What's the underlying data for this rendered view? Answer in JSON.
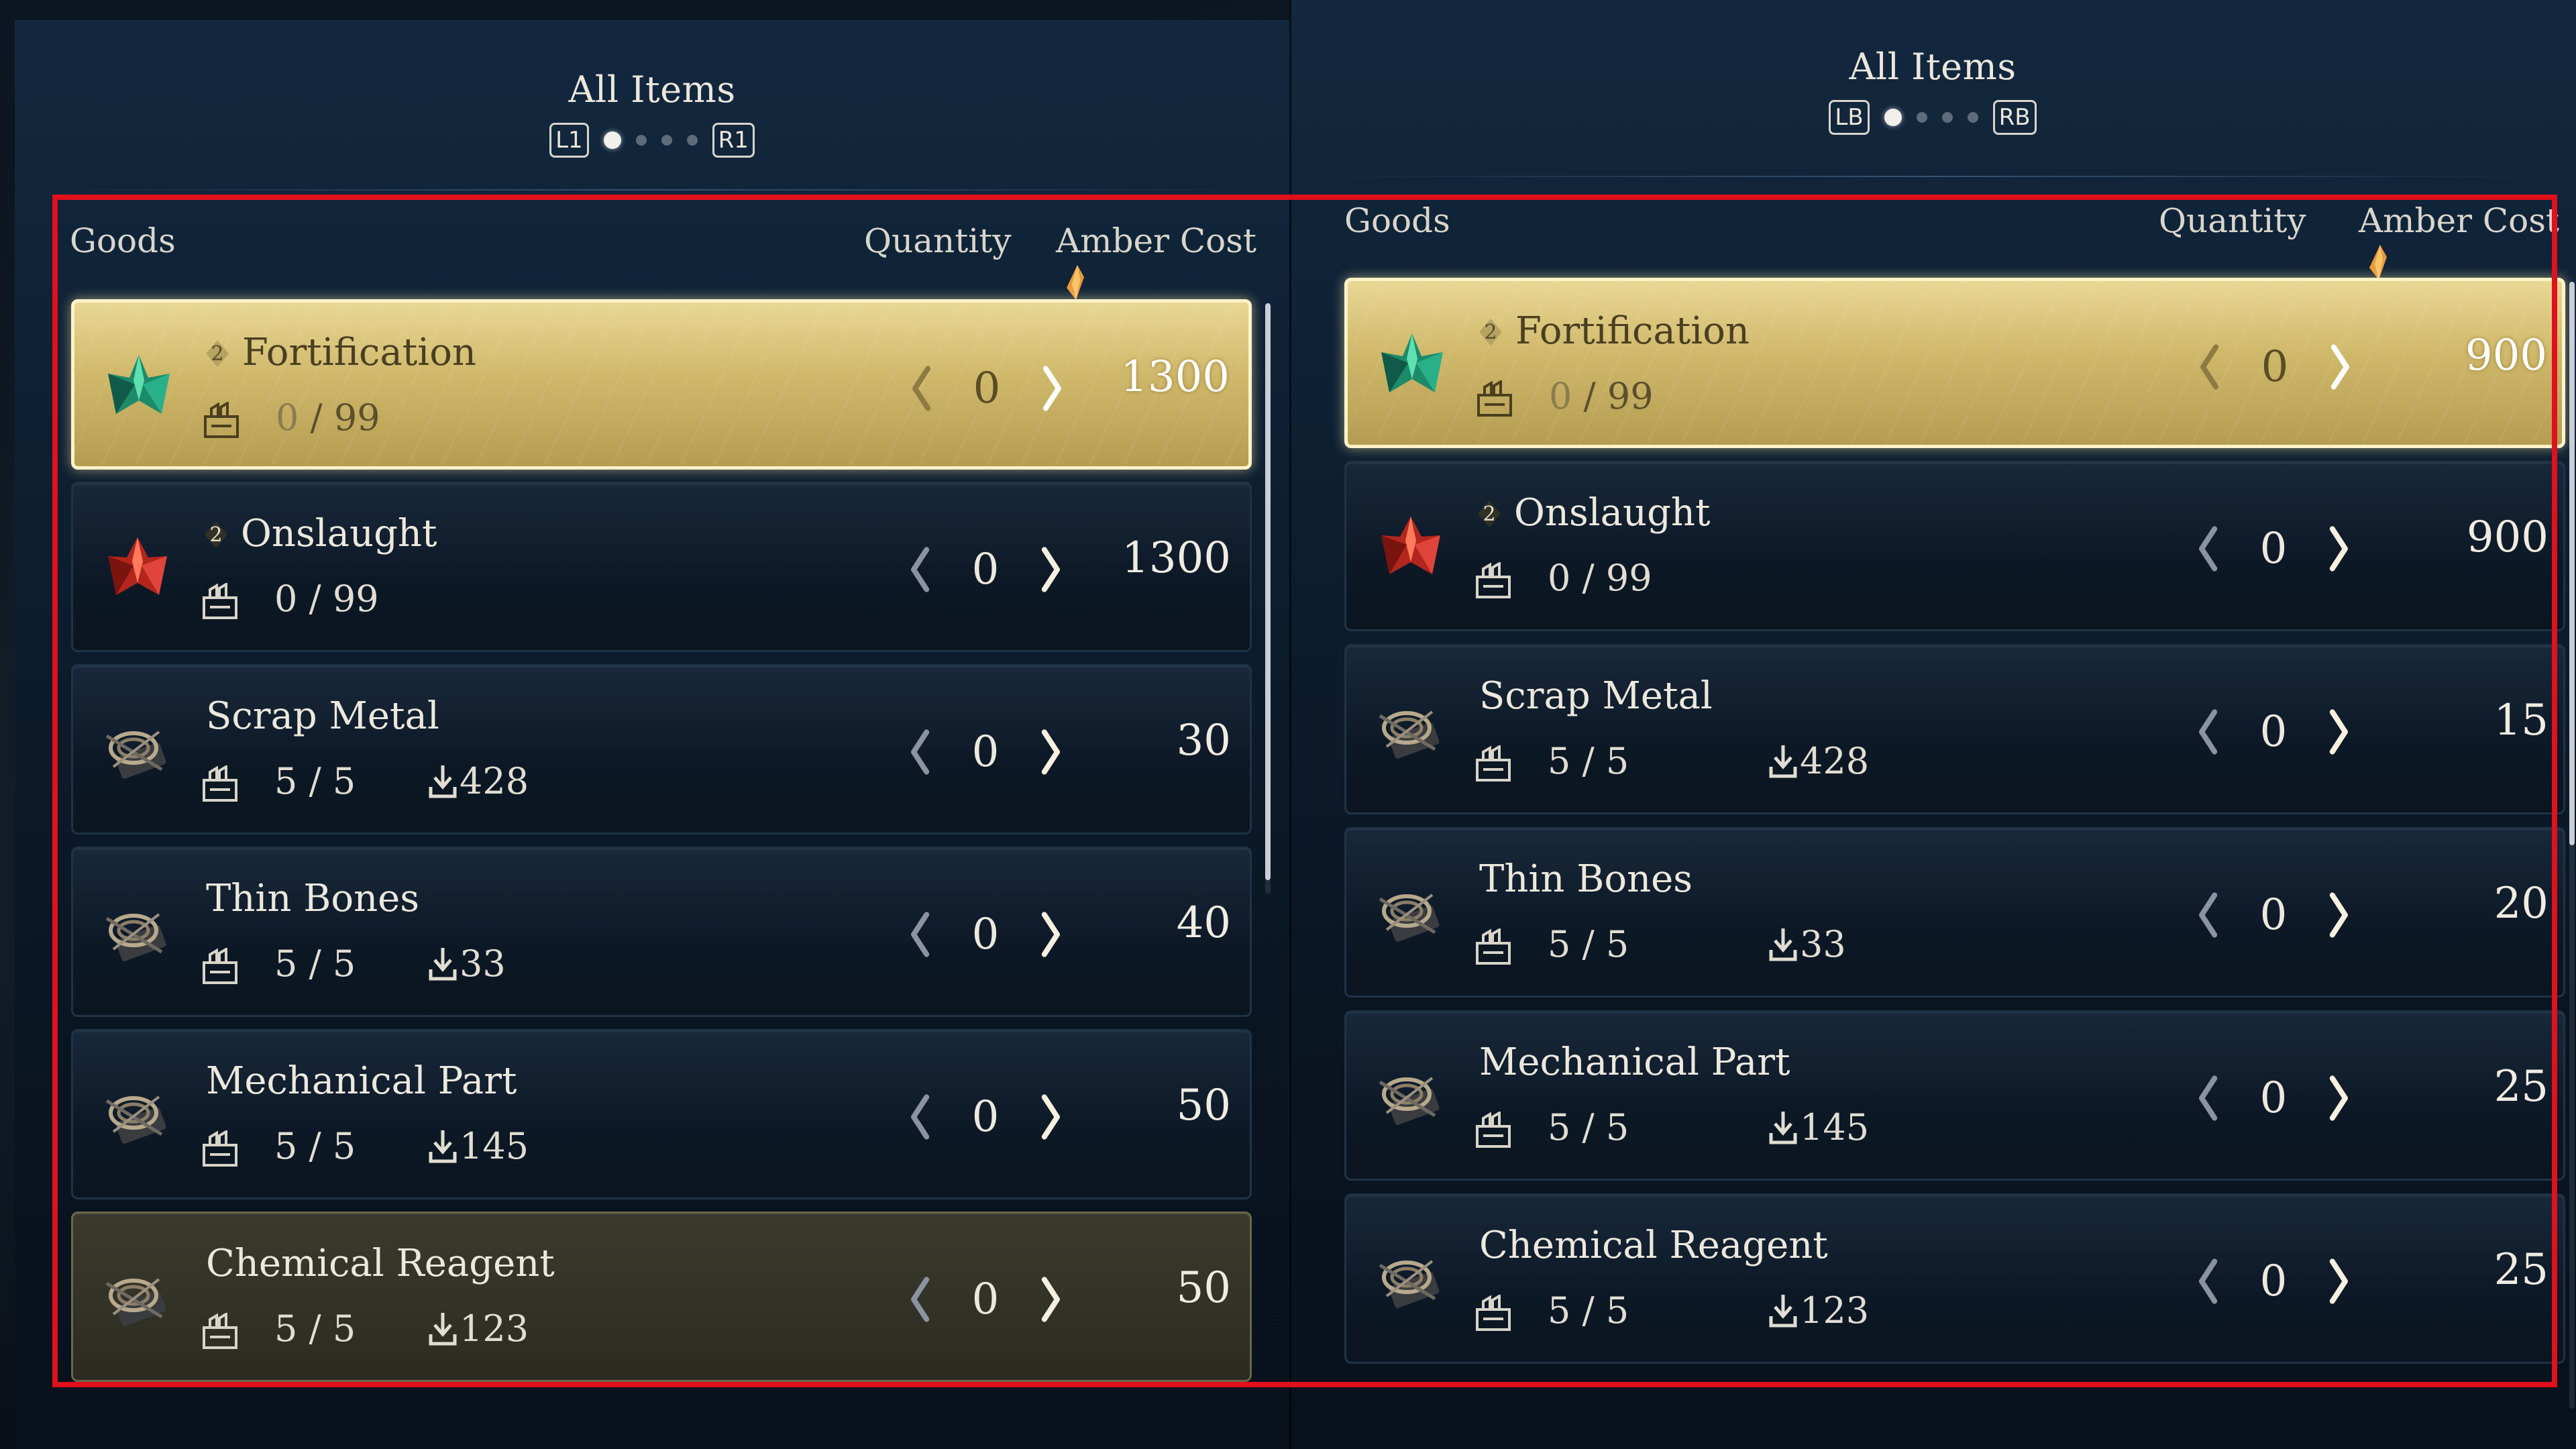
{
  "colors": {
    "selected_row": "#d7c27c",
    "row_bg": "#0d1826",
    "highlight_frame": "#e0101c",
    "amber": "#e89a3a"
  },
  "left_panel": {
    "title": "All Items",
    "prev_button": "L1",
    "next_button": "R1",
    "page_dots": 4,
    "active_page": 1,
    "columns": {
      "goods": "Goods",
      "quantity": "Quantity",
      "cost": "Amber Cost",
      "cost_icon": "amber-shard-icon"
    },
    "items": [
      {
        "name": "Fortification",
        "tier": "2",
        "icon": "green-crystal-icon",
        "stock": "0",
        "stock_max": "99",
        "owned": "",
        "quantity": "0",
        "cost": "1300",
        "state": "selected"
      },
      {
        "name": "Onslaught",
        "tier": "2",
        "icon": "red-crystal-icon",
        "stock": "0",
        "stock_max": "99",
        "owned": "",
        "quantity": "0",
        "cost": "1300",
        "state": "normal"
      },
      {
        "name": "Scrap Metal",
        "tier": "",
        "icon": "material-bundle-icon",
        "stock": "5",
        "stock_max": "5",
        "owned": "428",
        "quantity": "0",
        "cost": "30",
        "state": "normal"
      },
      {
        "name": "Thin Bones",
        "tier": "",
        "icon": "material-bundle-icon",
        "stock": "5",
        "stock_max": "5",
        "owned": "33",
        "quantity": "0",
        "cost": "40",
        "state": "normal"
      },
      {
        "name": "Mechanical Part",
        "tier": "",
        "icon": "material-bundle-icon",
        "stock": "5",
        "stock_max": "5",
        "owned": "145",
        "quantity": "0",
        "cost": "50",
        "state": "normal"
      },
      {
        "name": "Chemical Reagent",
        "tier": "",
        "icon": "material-bundle-icon",
        "stock": "5",
        "stock_max": "5",
        "owned": "123",
        "quantity": "0",
        "cost": "50",
        "state": "hovered"
      }
    ]
  },
  "right_panel": {
    "title": "All Items",
    "prev_button": "LB",
    "next_button": "RB",
    "page_dots": 4,
    "active_page": 1,
    "columns": {
      "goods": "Goods",
      "quantity": "Quantity",
      "cost": "Amber Cost",
      "cost_icon": "amber-shard-icon"
    },
    "items": [
      {
        "name": "Fortification",
        "tier": "2",
        "icon": "green-crystal-icon",
        "stock": "0",
        "stock_max": "99",
        "owned": "",
        "quantity": "0",
        "cost": "900",
        "state": "selected"
      },
      {
        "name": "Onslaught",
        "tier": "2",
        "icon": "red-crystal-icon",
        "stock": "0",
        "stock_max": "99",
        "owned": "",
        "quantity": "0",
        "cost": "900",
        "state": "normal"
      },
      {
        "name": "Scrap Metal",
        "tier": "",
        "icon": "material-bundle-icon",
        "stock": "5",
        "stock_max": "5",
        "owned": "428",
        "quantity": "0",
        "cost": "15",
        "state": "normal"
      },
      {
        "name": "Thin Bones",
        "tier": "",
        "icon": "material-bundle-icon",
        "stock": "5",
        "stock_max": "5",
        "owned": "33",
        "quantity": "0",
        "cost": "20",
        "state": "normal"
      },
      {
        "name": "Mechanical Part",
        "tier": "",
        "icon": "material-bundle-icon",
        "stock": "5",
        "stock_max": "5",
        "owned": "145",
        "quantity": "0",
        "cost": "25",
        "state": "normal"
      },
      {
        "name": "Chemical Reagent",
        "tier": "",
        "icon": "material-bundle-icon",
        "stock": "5",
        "stock_max": "5",
        "owned": "123",
        "quantity": "0",
        "cost": "25",
        "state": "normal"
      }
    ]
  }
}
